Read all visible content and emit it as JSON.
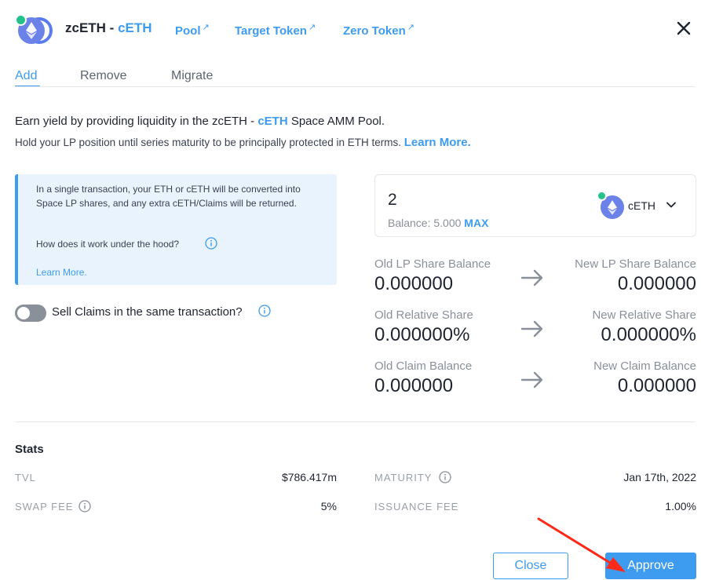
{
  "header": {
    "title_prefix": "zcETH - ",
    "title_accent": "cETH",
    "links": [
      {
        "label": "Pool",
        "ext": "↗"
      },
      {
        "label": "Target Token",
        "ext": "↗"
      },
      {
        "label": "Zero Token",
        "ext": "↗"
      }
    ]
  },
  "tabs": [
    "Add",
    "Remove",
    "Migrate"
  ],
  "intro": {
    "line1_prefix": "Earn yield by providing liquidity in the zcETH - ",
    "line1_accent": "cETH",
    "line1_suffix": " Space AMM Pool.",
    "line2": "Hold your LP position until series maturity to be principally protected in ETH terms. ",
    "learn_more": "Learn More."
  },
  "infobox": {
    "text": "In a single transaction, your ETH or cETH will be converted into Space LP shares, and any extra cETH/Claims will be returned.",
    "question": "How does it work under the hood?",
    "learn_more": "Learn More."
  },
  "toggle": {
    "label": "Sell Claims in the same transaction?",
    "on": false
  },
  "input": {
    "amount": "2",
    "balance_label": "Balance: 5.000",
    "max_label": "MAX",
    "token": "cETH"
  },
  "shares": [
    {
      "old_label": "Old LP Share Balance",
      "old_value": "0.000000",
      "new_label": "New LP Share Balance",
      "new_value": "0.000000"
    },
    {
      "old_label": "Old Relative Share",
      "old_value": "0.000000%",
      "new_label": "New Relative Share",
      "new_value": "0.000000%"
    },
    {
      "old_label": "Old Claim Balance",
      "old_value": "0.000000",
      "new_label": "New Claim Balance",
      "new_value": "0.000000"
    }
  ],
  "stats": {
    "heading": "Stats",
    "tvl_label": "TVL",
    "tvl_value": "$786.417m",
    "maturity_label": "MATURITY",
    "maturity_value": "Jan 17th, 2022",
    "swap_fee_label": "SWAP FEE",
    "swap_fee_value": "5%",
    "issuance_fee_label": "ISSUANCE FEE",
    "issuance_fee_value": "1.00%"
  },
  "buttons": {
    "close": "Close",
    "approve": "Approve"
  },
  "colors": {
    "accent": "#3d9cf0",
    "infobox_bg": "#e9f3fe",
    "badge": "#21c38a",
    "annotation": "#ff2a1a"
  }
}
